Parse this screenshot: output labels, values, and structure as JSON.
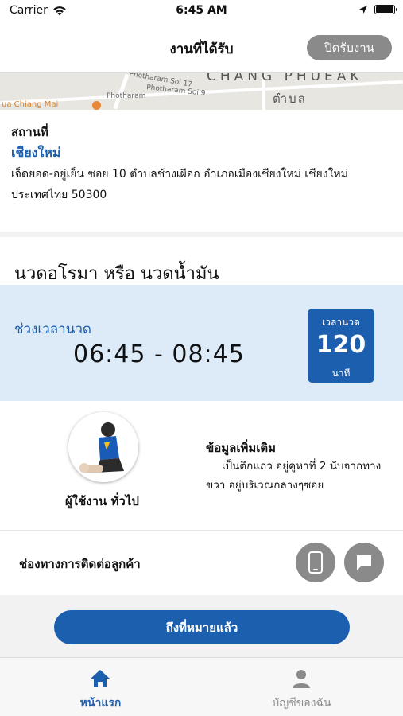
{
  "status_bar": {
    "carrier": "Carrier",
    "time": "6:45 AM"
  },
  "nav": {
    "title": "งานที่ได้รับ",
    "close_button": "ปิดรับงาน"
  },
  "map": {
    "area_label": "CHANG PHUEAK",
    "tambon_label": "ตำบล",
    "poi_label": "ua Chiang Mai",
    "streets": [
      "Photharam Soi 17",
      "Photharam Soi 9",
      "Photharam"
    ]
  },
  "location": {
    "heading": "สถานที่",
    "city": "เชียงใหม่",
    "address": "เจ็ดยอด-อยู่เย็น ซอย 10 ตำบลช้างเผือก อำเภอเมืองเชียงใหม่ เชียงใหม่ ประเทศไทย 50300"
  },
  "service": {
    "title": "นวดอโรมา หรือ นวดน้ำมัน",
    "time_label": "ช่วงเวลานวด",
    "time_range": "06:45 - 08:45",
    "duration": {
      "label": "เวลานวด",
      "value": "120",
      "unit": "นาที"
    }
  },
  "user": {
    "role": "ผู้ใช้งาน ทั่วไป"
  },
  "info": {
    "heading": "ข้อมูลเพิ่มเติม",
    "text": "เป็นตึกแถว อยู่คูหาที่ 2 นับจากทาง ขวา อยู่บริเวณกลางๆซอย"
  },
  "contact": {
    "label": "ช่องทางการติดต่อลูกค้า",
    "icons": [
      "phone-icon",
      "chat-icon"
    ]
  },
  "action": {
    "arrived_button": "ถึงที่หมายแล้ว"
  },
  "tabs": [
    {
      "label": "หน้าแรก",
      "icon": "home-icon",
      "active": true
    },
    {
      "label": "บัญชีของฉัน",
      "icon": "person-icon",
      "active": false
    }
  ],
  "colors": {
    "accent": "#1b5fae",
    "time_panel": "#ddebf9",
    "muted_button": "#8a8a8a"
  }
}
